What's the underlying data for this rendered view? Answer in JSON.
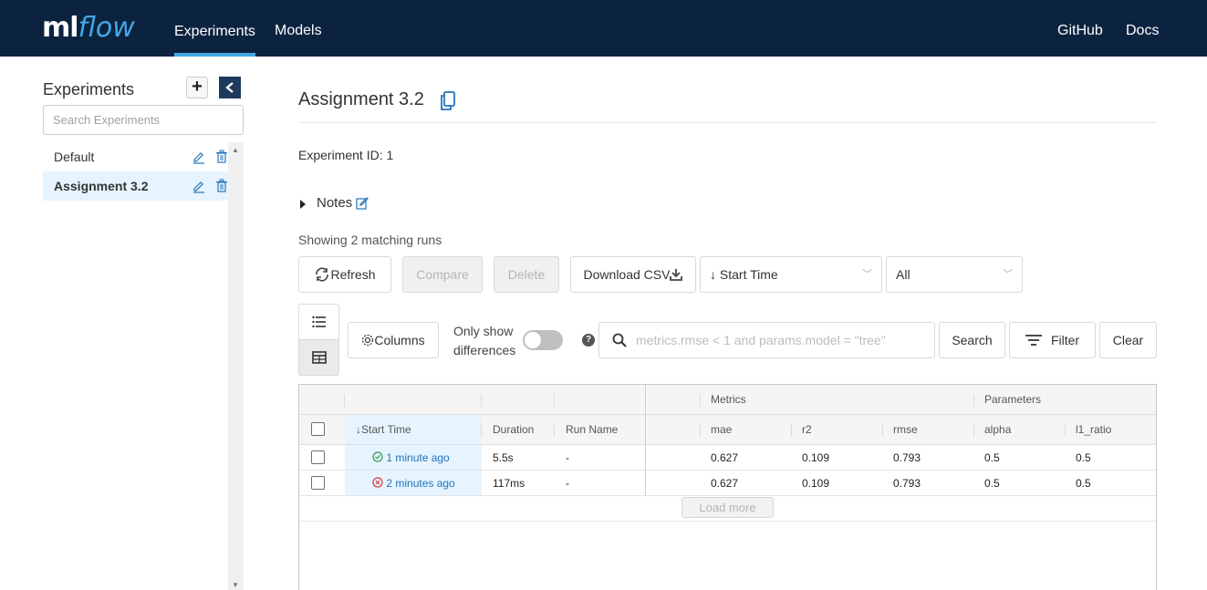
{
  "header": {
    "logo_ml": "ml",
    "logo_flow": "flow",
    "nav": {
      "experiments": "Experiments",
      "models": "Models",
      "github": "GitHub",
      "docs": "Docs"
    },
    "active_tab": "Experiments"
  },
  "sidebar": {
    "title": "Experiments",
    "add_label": "+",
    "search_placeholder": "Search Experiments",
    "items": [
      {
        "label": "Default",
        "active": false
      },
      {
        "label": "Assignment 3.2",
        "active": true
      }
    ]
  },
  "main": {
    "title": "Assignment 3.2",
    "experiment_id_label": "Experiment ID:",
    "experiment_id": "1",
    "notes_label": "Notes",
    "showing_text": "Showing 2 matching runs",
    "toolbar": {
      "refresh": "Refresh",
      "compare": "Compare",
      "delete": "Delete",
      "download_csv": "Download CSV",
      "sort_value": "Start Time",
      "lifecycle_value": "All",
      "columns": "Columns",
      "only_show_line1": "Only show",
      "only_show_line2": "differences",
      "help": "?",
      "search_placeholder": "metrics.rmse < 1 and params.model = \"tree\"",
      "search_button": "Search",
      "filter_button": "Filter",
      "clear_button": "Clear"
    },
    "table": {
      "group_headers": {
        "metrics": "Metrics",
        "parameters": "Parameters"
      },
      "columns": {
        "start_time": "Start Time",
        "duration": "Duration",
        "run_name": "Run Name",
        "mae": "mae",
        "r2": "r2",
        "rmse": "rmse",
        "alpha": "alpha",
        "l1_ratio": "l1_ratio"
      },
      "rows": [
        {
          "status": "success",
          "start_time": "1 minute ago",
          "duration": "5.5s",
          "run_name": "-",
          "mae": "0.627",
          "r2": "0.109",
          "rmse": "0.793",
          "alpha": "0.5",
          "l1_ratio": "0.5"
        },
        {
          "status": "failed",
          "start_time": "2 minutes ago",
          "duration": "117ms",
          "run_name": "-",
          "mae": "0.627",
          "r2": "0.109",
          "rmse": "0.793",
          "alpha": "0.5",
          "l1_ratio": "0.5"
        }
      ],
      "load_more": "Load more"
    }
  },
  "colors": {
    "header_bg": "#0c2340",
    "accent": "#43a8e6",
    "link": "#2374bb",
    "success": "#2e9e4f",
    "failed": "#d9363e",
    "selected_row_bg": "#e6f4ff"
  }
}
